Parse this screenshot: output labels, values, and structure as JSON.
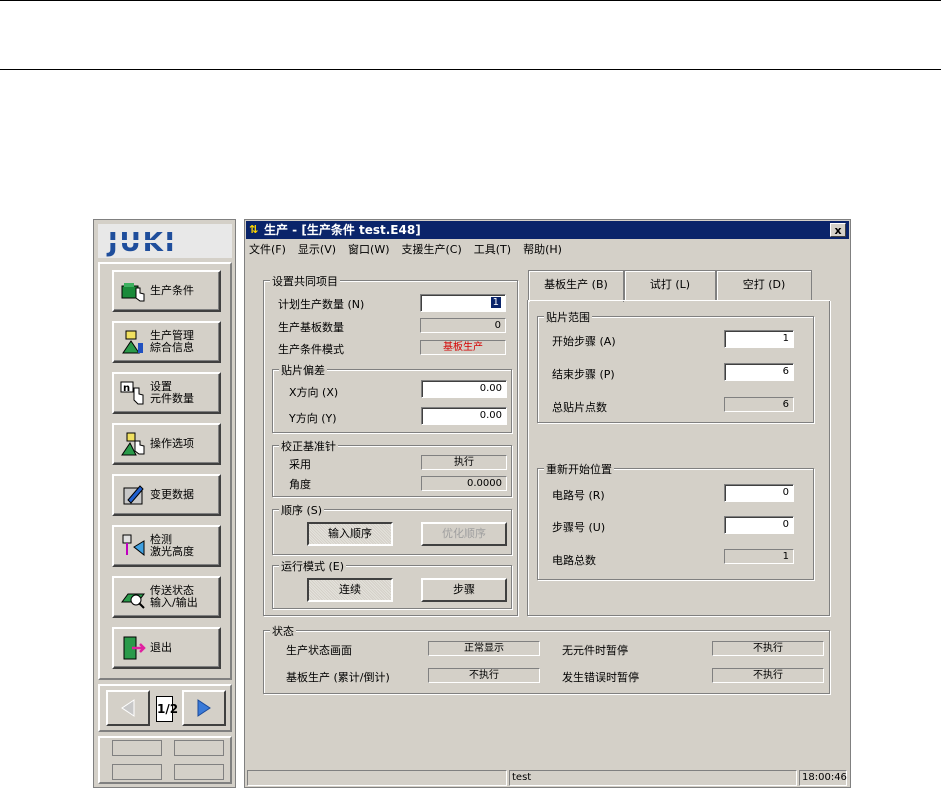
{
  "sidebar": {
    "logo": "JUKI",
    "buttons": [
      {
        "line1": "生产条件",
        "line2": ""
      },
      {
        "line1": "生产管理",
        "line2": "綜合信息"
      },
      {
        "line1": "设置",
        "line2": "元件数量"
      },
      {
        "line1": "操作选项",
        "line2": ""
      },
      {
        "line1": "变更数据",
        "line2": ""
      },
      {
        "line1": "检测",
        "line2": "激光高度"
      },
      {
        "line1": "传送状态",
        "line2": "输入/输出"
      },
      {
        "line1": "退出",
        "line2": ""
      }
    ],
    "page": "1/2"
  },
  "window": {
    "title": "生产 - [生产条件 test.E48]",
    "close": "x",
    "menu": [
      "文件(F)",
      "显示(V)",
      "窗口(W)",
      "支援生产(C)",
      "工具(T)",
      "帮助(H)"
    ]
  },
  "common": {
    "title": "设置共同项目",
    "plan_qty_label": "计划生产数量 (N)",
    "plan_qty": "1",
    "board_qty_label": "生产基板数量",
    "board_qty": "0",
    "mode_label": "生产条件模式",
    "mode_value": "基板生产",
    "offset": {
      "title": "贴片偏差",
      "x_label": "X方向 (X)",
      "x_value": "0.00",
      "y_label": "Y方向 (Y)",
      "y_value": "0.00"
    },
    "pin": {
      "title": "校正基准针",
      "use_label": "采用",
      "use_value": "执行",
      "angle_label": "角度",
      "angle_value": "0.0000"
    },
    "order": {
      "title": "顺序 (S)",
      "input_btn": "输入顺序",
      "optimize_btn": "优化顺序"
    },
    "run": {
      "title": "运行模式 (E)",
      "cont_btn": "连续",
      "step_btn": "步骤"
    }
  },
  "tabs": [
    "基板生产 (B)",
    "试打 (L)",
    "空打 (D)"
  ],
  "placement": {
    "title": "贴片范围",
    "start_label": "开始步骤 (A)",
    "start_value": "1",
    "end_label": "结束步骤 (P)",
    "end_value": "6",
    "total_label": "总贴片点数",
    "total_value": "6"
  },
  "restart": {
    "title": "重新开始位置",
    "circuit_label": "电路号 (R)",
    "circuit_value": "0",
    "step_label": "步骤号 (U)",
    "step_value": "0",
    "total_label": "电路总数",
    "total_value": "1"
  },
  "state": {
    "title": "状态",
    "screen_label": "生产状态画面",
    "screen_value": "正常显示",
    "no_part_label": "无元件时暂停",
    "no_part_value": "不执行",
    "board_label": "基板生产 (累计/倒计)",
    "board_value": "不执行",
    "error_label": "发生错误时暂停",
    "error_value": "不执行"
  },
  "statusbar": {
    "file": "test",
    "time": "18:00:46"
  },
  "colors": {
    "title_bar": "#0a246a",
    "mode_value": "#d40000",
    "logo": "#1f4e9c"
  }
}
